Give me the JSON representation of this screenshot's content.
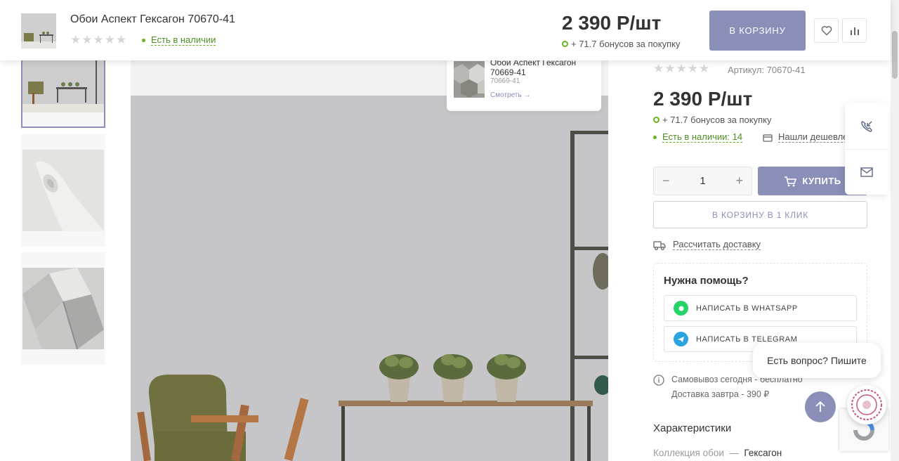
{
  "header": {
    "product_title": "Обои Аспект Гексагон 70670-41",
    "stars": [
      "★",
      "★",
      "★",
      "★",
      "★"
    ],
    "stock_label": "Есть в наличии",
    "price": "2 390 Р/шт",
    "bonus": "+ 71.7 бонусов за покупку",
    "cart_button": "В КОРЗИНУ",
    "icons": {
      "favorite": "heart-icon",
      "compare": "bar-chart-icon"
    }
  },
  "mini_card": {
    "title": "Обои Аспект Гексагон 70669-41",
    "sku": "70669-41",
    "link": "Смотреть →"
  },
  "product": {
    "stars": [
      "★",
      "★",
      "★",
      "★",
      "★"
    ],
    "sku_label": "Артикул: 70670-41",
    "price": "2 390 Р/шт",
    "bonus": "+ 71.7 бонусов за покупку",
    "stock_label": "Есть в наличии: 14",
    "cheaper_label": "Нашли дешевле?",
    "quantity": "1",
    "minus": "−",
    "plus": "+",
    "buy_button": "КУПИТЬ",
    "one_click_button": "В КОРЗИНУ В 1 КЛИК",
    "delivery_calc": "Рассчитать доставку"
  },
  "help": {
    "title": "Нужна помощь?",
    "whatsapp": "НАПИСАТЬ В WHATSAPP",
    "telegram": "НАПИСАТЬ В TELEGRAM"
  },
  "delivery_info": {
    "pickup": "Самовывоз сегодня - бесплатно",
    "courier": "Доставка завтра - 390 ₽"
  },
  "specs": {
    "title": "Характеристики",
    "rows": [
      {
        "name": "Коллекция обои",
        "dash": "—",
        "value": "Гексагон"
      }
    ]
  },
  "chat": {
    "bubble": "Есть вопрос? Пишите"
  },
  "colors": {
    "accent": "#8a8fb8",
    "stock_green": "#6ab121",
    "whatsapp": "#25d366",
    "telegram": "#2aa3e0"
  }
}
